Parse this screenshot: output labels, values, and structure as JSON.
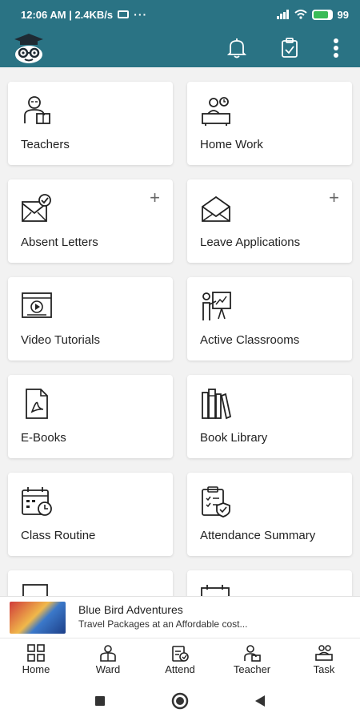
{
  "status_bar": {
    "time": "12:06 AM | 2.4KB/s",
    "more": "···",
    "battery": "99"
  },
  "app_bar": {
    "bg_color": "#2a7384"
  },
  "cards": [
    {
      "label": "Teachers",
      "icon": "teacher-icon",
      "has_add": false
    },
    {
      "label": "Home Work",
      "icon": "homework-icon",
      "has_add": false
    },
    {
      "label": "Absent Letters",
      "icon": "absent-letter-icon",
      "has_add": true,
      "add_symbol": "+"
    },
    {
      "label": "Leave Applications",
      "icon": "leave-application-icon",
      "has_add": true,
      "add_symbol": "+"
    },
    {
      "label": "Video Tutorials",
      "icon": "video-tutorial-icon",
      "has_add": false
    },
    {
      "label": "Active Classrooms",
      "icon": "classroom-icon",
      "has_add": false
    },
    {
      "label": "E-Books",
      "icon": "pdf-icon",
      "has_add": false
    },
    {
      "label": "Book Library",
      "icon": "books-icon",
      "has_add": false
    },
    {
      "label": "Class Routine",
      "icon": "routine-calendar-icon",
      "has_add": false
    },
    {
      "label": "Attendance Summary",
      "icon": "attendance-clipboard-icon",
      "has_add": false
    }
  ],
  "ad": {
    "title": "Blue Bird Adventures",
    "subtitle": "Travel Packages at an Affordable cost..."
  },
  "bottom_nav": [
    {
      "label": "Home",
      "icon": "home-grid-icon"
    },
    {
      "label": "Ward",
      "icon": "ward-icon"
    },
    {
      "label": "Attend",
      "icon": "attend-icon"
    },
    {
      "label": "Teacher",
      "icon": "teacher-nav-icon"
    },
    {
      "label": "Task",
      "icon": "task-icon"
    }
  ]
}
